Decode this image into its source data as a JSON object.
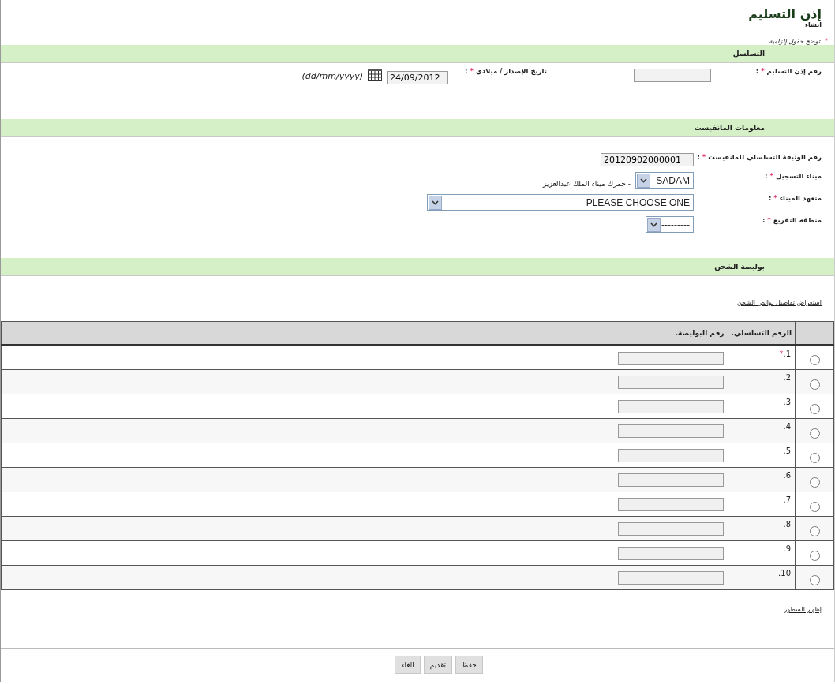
{
  "page": {
    "title": "إذن التسليم",
    "subtitle": "انشاء",
    "required_note": "توضح حقول إلزامية",
    "required_mark": "*",
    "colon": ":"
  },
  "sections": [
    {
      "kind": "serial",
      "title": "التسلسل",
      "fields": [
        {
          "label": "رقم إذن التسليم"
        }
      ],
      "date": {
        "label": "تاريخ الإصدار / ميلادي",
        "value": "24/09/2012",
        "format": "(dd/mm/yyyy)"
      }
    },
    {
      "kind": "manifest",
      "title": "معلومات المانفيست",
      "fields": [
        {
          "kind": "text",
          "label": "رقم الوثيقة التسلسلي للمانفيست",
          "value": "20120902000001"
        },
        {
          "kind": "select",
          "label": "ميناء التسجيل",
          "value": "SADAM",
          "note": "- جمرك ميناء الملك عبدالعزيز"
        },
        {
          "kind": "wide-select",
          "label": "متعهد الميناء",
          "value": "PLEASE CHOOSE ONE"
        },
        {
          "kind": "select",
          "label": "منطقة التفريغ",
          "value": "---------"
        }
      ]
    },
    {
      "kind": "bills",
      "title": "بوليصة الشحن",
      "link": "استعراض تفاصيل بوالص الشحن"
    }
  ],
  "table": {
    "columns": [
      "الرقم التسلسلي.",
      "رقم البوليصة."
    ],
    "rows": [
      {
        "number": "1.",
        "required": true,
        "selected": false
      },
      {
        "number": "2.",
        "required": false,
        "selected": false
      },
      {
        "number": "3.",
        "required": false,
        "selected": false
      },
      {
        "number": "4.",
        "required": false,
        "selected": false
      },
      {
        "number": "5.",
        "required": false,
        "selected": false
      },
      {
        "number": "6.",
        "required": false,
        "selected": false
      },
      {
        "number": "7.",
        "required": false,
        "selected": false
      },
      {
        "number": "8.",
        "required": false,
        "selected": false
      },
      {
        "number": "9.",
        "required": false,
        "selected": false
      },
      {
        "number": "10.",
        "required": false,
        "selected": false
      }
    ]
  },
  "show_rows_link": "إظهار السطور",
  "buttons": [
    "حفظ",
    "تقديم",
    "الغاء"
  ]
}
